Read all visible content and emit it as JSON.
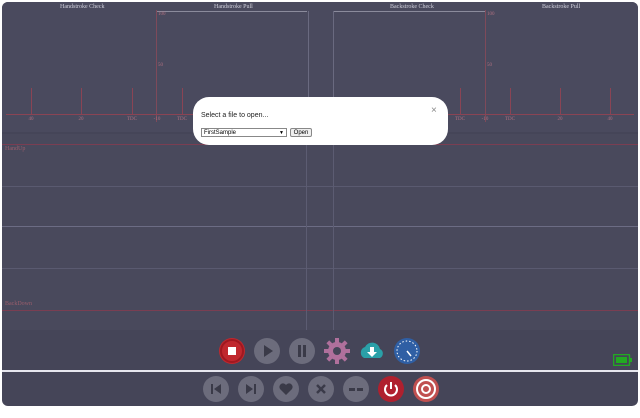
{
  "sections": [
    {
      "label": "Handstroke Check"
    },
    {
      "label": "Handstroke Pull"
    },
    {
      "label": "Backstroke Check"
    },
    {
      "label": "Backstroke Pull"
    }
  ],
  "scale": {
    "top_marks": [
      "100",
      "100"
    ],
    "mid_marks": [
      "50",
      "50"
    ],
    "tick_labels": [
      "40",
      "20",
      "TDC",
      "-10",
      "TDC",
      "TDC",
      "-10",
      "TDC",
      "20",
      "40"
    ]
  },
  "graph": {
    "top_label": "HandUp",
    "bottom_label": "BackDown"
  },
  "toolbar_top": [
    {
      "icon": "stop-icon",
      "color": "#c0282e"
    },
    {
      "icon": "play-icon",
      "color": "#6c6c7c"
    },
    {
      "icon": "pause-icon",
      "color": "#6c6c7c"
    },
    {
      "icon": "gear-icon",
      "color": "#b0709c"
    },
    {
      "icon": "cloud-download-icon",
      "color": "#2aa0a8"
    },
    {
      "icon": "gauge-icon",
      "color": "#2f5fa4"
    }
  ],
  "toolbar_bottom": [
    {
      "icon": "skip-back-icon",
      "color": "#6c6c7c"
    },
    {
      "icon": "skip-forward-icon",
      "color": "#6c6c7c"
    },
    {
      "icon": "heart-icon",
      "color": "#6c6c7c"
    },
    {
      "icon": "close-icon",
      "color": "#6c6c7c"
    },
    {
      "icon": "dash-icon",
      "color": "#6c6c7c"
    },
    {
      "icon": "power-icon",
      "color": "#b0202e"
    },
    {
      "icon": "lifebuoy-icon",
      "color": "#c05050"
    }
  ],
  "battery": {
    "icon": "battery-icon",
    "color": "#22aa22"
  },
  "dialog": {
    "title": "Select a file to open...",
    "close": "×",
    "selected_file": "FirstSample",
    "open_label": "Open"
  }
}
